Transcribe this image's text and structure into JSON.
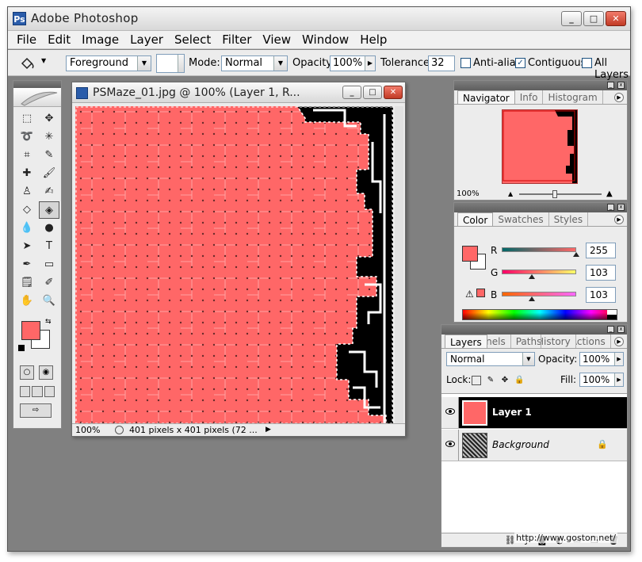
{
  "app": {
    "title": "Adobe  Photoshop",
    "logo": "Ps",
    "minimize": "_",
    "maximize": "□",
    "close": "✕"
  },
  "menu": [
    "File",
    "Edit",
    "Image",
    "Layer",
    "Select",
    "Filter",
    "View",
    "Window",
    "Help"
  ],
  "options": {
    "tool_icon": "paint-bucket-icon",
    "fill_source": "Foreground",
    "mode_label": "Mode:",
    "mode_value": "Normal",
    "opacity_label": "Opacity:",
    "opacity_value": "100%",
    "tolerance_label": "Tolerance:",
    "tolerance_value": "32",
    "antialias_label": "Anti-alias",
    "antialias_checked": false,
    "contiguous_label": "Contiguous",
    "contiguous_checked": true,
    "all_layers_label": "All Layers",
    "all_layers_checked": false
  },
  "document": {
    "title": "PSMaze_01.jpg  @  100%  (Layer 1,  R...",
    "zoom": "100%",
    "info": "401 pixels x 401 pixels (72 ...",
    "fill_color": "#ff6767"
  },
  "navigator": {
    "tabs": [
      "Navigator",
      "Info",
      "Histogram"
    ],
    "zoom": "100%"
  },
  "color_panel": {
    "tabs": [
      "Color",
      "Swatches",
      "Styles"
    ],
    "channels": [
      {
        "label": "R",
        "value": "255",
        "level": 1.0
      },
      {
        "label": "G",
        "value": "103",
        "level": 0.404
      },
      {
        "label": "B",
        "value": "103",
        "level": 0.404
      }
    ],
    "warning": "⚠"
  },
  "layers_panel": {
    "tabs": [
      "Layers",
      "Channels",
      "Paths",
      "History",
      "Actions"
    ],
    "blend_mode": "Normal",
    "opacity_label": "Opacity:",
    "opacity_value": "100%",
    "lock_label": "Lock:",
    "fill_label": "Fill:",
    "fill_value": "100%",
    "layers": [
      {
        "name": "Layer 1",
        "selected": true
      },
      {
        "name": "Background",
        "selected": false
      }
    ]
  },
  "watermark": "http://www.goston.net/"
}
